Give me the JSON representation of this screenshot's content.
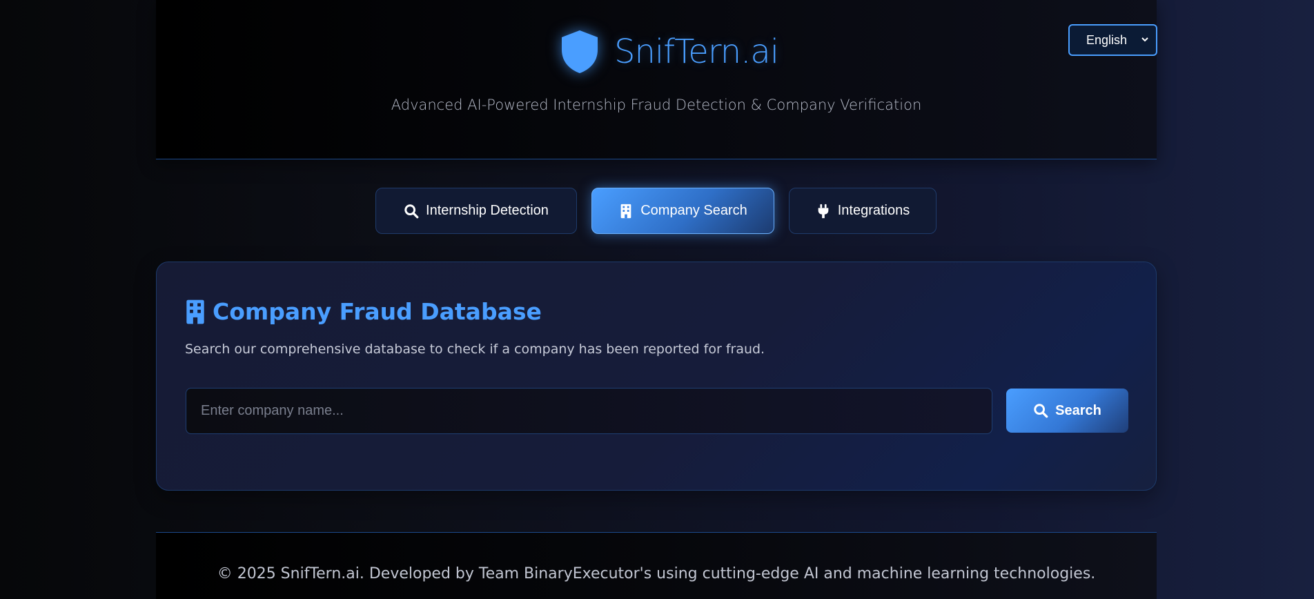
{
  "header": {
    "brand_name": "SnifTern.ai",
    "tagline": "Advanced AI-Powered Internship Fraud Detection & Company Verification",
    "language": "English"
  },
  "tabs": [
    {
      "label": "Internship Detection",
      "icon": "search-icon",
      "active": false
    },
    {
      "label": "Company Search",
      "icon": "building-icon",
      "active": true
    },
    {
      "label": "Integrations",
      "icon": "plug-icon",
      "active": false
    }
  ],
  "card": {
    "title": "Company Fraud Database",
    "icon": "building-icon",
    "description": "Search our comprehensive database to check if a company has been reported for fraud.",
    "search_placeholder": "Enter company name...",
    "search_value": "",
    "search_button": "Search"
  },
  "footer": {
    "text": "© 2025 SnifTern.ai. Developed by Team BinaryExecutor's using cutting-edge AI and machine learning technologies."
  },
  "colors": {
    "accent": "#4a9eff",
    "background": "#0c0e16",
    "card": "#161c3a"
  }
}
